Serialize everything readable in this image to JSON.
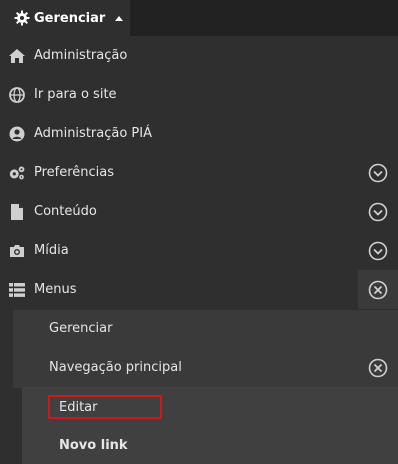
{
  "topbar": {
    "manage_label": "Gerenciar"
  },
  "menu": {
    "items": [
      {
        "label": "Administração",
        "icon": "home-icon"
      },
      {
        "label": "Ir para o site",
        "icon": "globe-icon"
      },
      {
        "label": "Administração PIÁ",
        "icon": "user-icon"
      },
      {
        "label": "Preferências",
        "icon": "cogs-icon"
      },
      {
        "label": "Conteúdo",
        "icon": "file-icon"
      },
      {
        "label": "Mídia",
        "icon": "camera-icon"
      },
      {
        "label": "Menus",
        "icon": "list-icon"
      }
    ],
    "menus_sub": [
      {
        "label": "Gerenciar"
      },
      {
        "label": "Navegação principal"
      }
    ],
    "nav_sub": [
      {
        "label": "Editar"
      },
      {
        "label": "Novo link"
      }
    ]
  },
  "colors": {
    "highlight_border": "#d01818"
  }
}
